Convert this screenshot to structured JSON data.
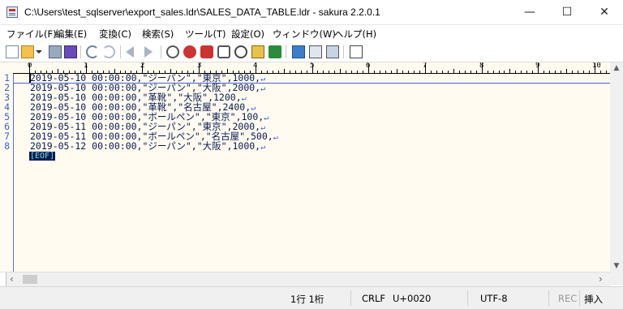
{
  "window": {
    "title": "C:\\Users\\test_sqlserver\\export_sales.ldr\\SALES_DATA_TABLE.ldr - sakura 2.2.0.1",
    "minimize_glyph": "—",
    "maximize_glyph": "☐",
    "close_glyph": "✕"
  },
  "menu": {
    "items": [
      "ファイル(F)",
      "編集(E)",
      "変換(C)",
      "検索(S)",
      "ツール(T)",
      "設定(O)",
      "ウィンドウ(W)",
      "ヘルプ(H)"
    ]
  },
  "toolbar": {
    "icons": [
      "new-file",
      "open-file",
      "open-dropdown",
      "save",
      "save-all",
      "undo",
      "redo",
      "jump-back",
      "jump-forward",
      "search-previous",
      "search-next",
      "search",
      "replace",
      "grep",
      "compare",
      "bookmark",
      "outline",
      "split-horizontal",
      "split-vertical",
      "settings"
    ]
  },
  "ruler": {
    "labels": [
      "0",
      "1",
      "2",
      "3",
      "4",
      "5",
      "6",
      "7",
      "8",
      "9",
      "10"
    ]
  },
  "document": {
    "lines": [
      {
        "no": "1",
        "text": "2019-05-10 00:00:00,\"ジーパン\",\"東京\",1000,"
      },
      {
        "no": "2",
        "text": "2019-05-10 00:00:00,\"ジーパン\",\"大阪\",2000,"
      },
      {
        "no": "3",
        "text": "2019-05-10 00:00:00,\"革靴\",\"大阪\",1200,"
      },
      {
        "no": "4",
        "text": "2019-05-10 00:00:00,\"革靴\",\"名古屋\",2400,"
      },
      {
        "no": "5",
        "text": "2019-05-10 00:00:00,\"ボールペン\",\"東京\",100,"
      },
      {
        "no": "6",
        "text": "2019-05-11 00:00:00,\"ジーパン\",\"東京\",2000,"
      },
      {
        "no": "7",
        "text": "2019-05-11 00:00:00,\"ボールペン\",\"名古屋\",500,"
      },
      {
        "no": "8",
        "text": "2019-05-12 00:00:00,\"ジーパン\",\"大阪\",1000,"
      }
    ],
    "crlf_mark": "↵",
    "eof_mark": "[EOF]"
  },
  "status": {
    "position": "1行  1桁",
    "line_ending": "CRLF",
    "char_code": "U+0020",
    "encoding": "UTF-8",
    "rec": "REC",
    "mode": "挿入"
  },
  "colors": {
    "editor_background": "#fffbf0",
    "text": "#0a1a52",
    "line_number": "#3b5fd0",
    "eof_background": "#0a1a52",
    "eof_text": "#6be3e3"
  }
}
